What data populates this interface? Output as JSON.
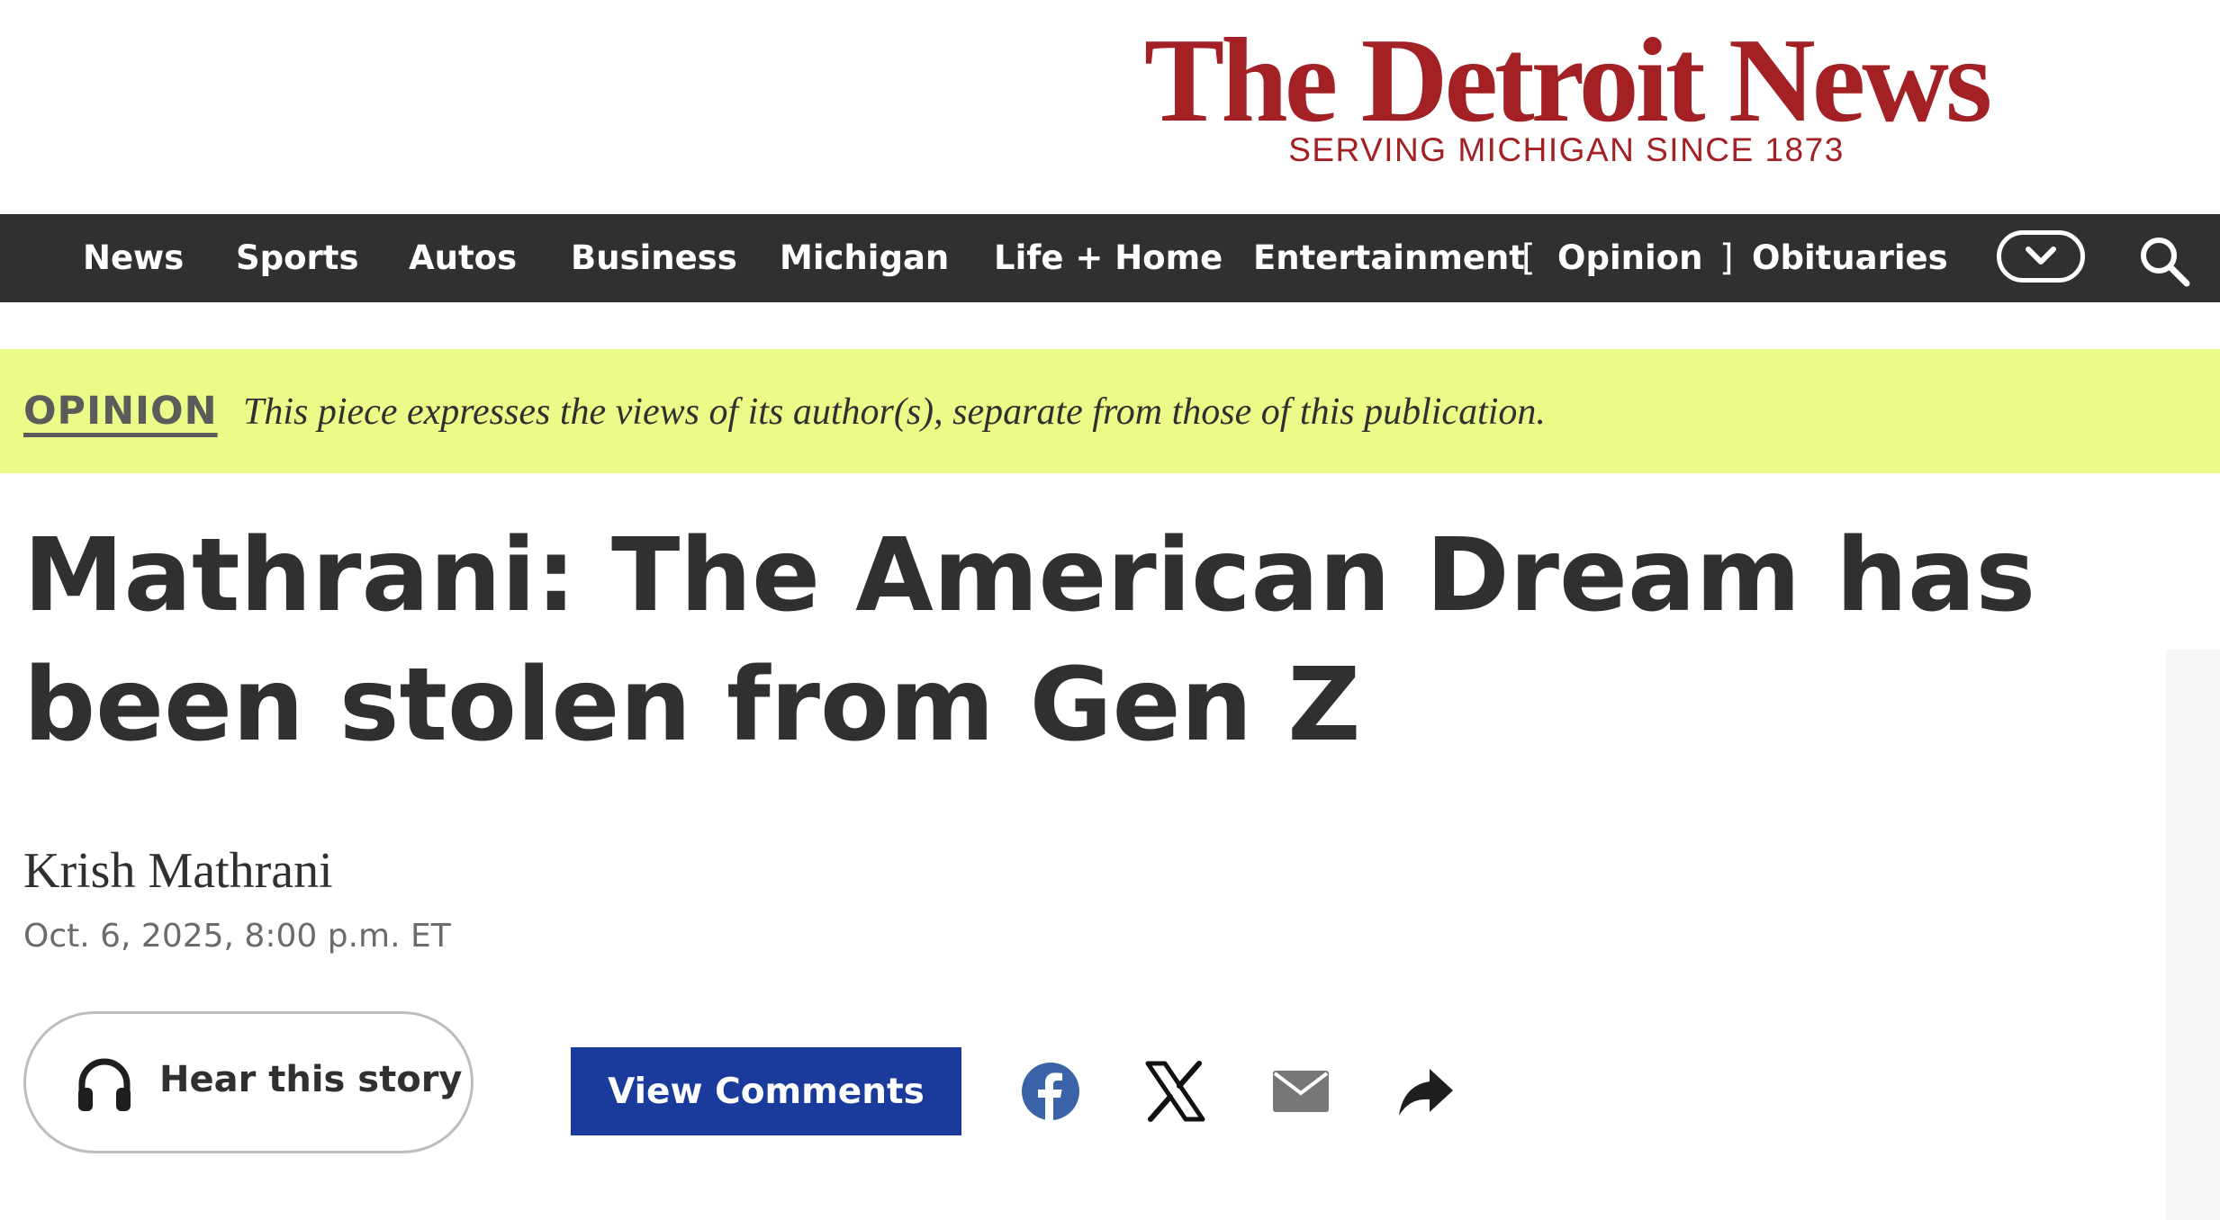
{
  "masthead": {
    "logo": "The Detroit News",
    "tagline": "SERVING MICHIGAN SINCE 1873"
  },
  "nav": {
    "items": [
      "News",
      "Sports",
      "Autos",
      "Business",
      "Michigan",
      "Life + Home",
      "Entertainment",
      "Opinion",
      "Obituaries"
    ],
    "active": "Opinion",
    "bracket_open": "[",
    "bracket_close": "]",
    "icons": {
      "more": "chevron-down-icon",
      "search": "search-icon"
    }
  },
  "opinion_banner": {
    "label": "OPINION",
    "text": "This piece expresses the views of its author(s), separate from those of this publication."
  },
  "article": {
    "headline": "Mathrani: The American Dream has been stolen from Gen Z",
    "author": "Krish Mathrani",
    "date": "Oct. 6, 2025, 8:00 p.m. ET"
  },
  "actions": {
    "hear_label": "Hear this story",
    "comments_label": "View Comments",
    "share_icons": [
      "facebook-icon",
      "x-icon",
      "email-icon",
      "share-icon"
    ]
  },
  "colors": {
    "brand_red": "#a32024",
    "nav_bg": "#303030",
    "opinion_bg": "#ecfb88",
    "comments_bg": "#1a3b9c",
    "facebook_blue": "#3b64a8"
  }
}
